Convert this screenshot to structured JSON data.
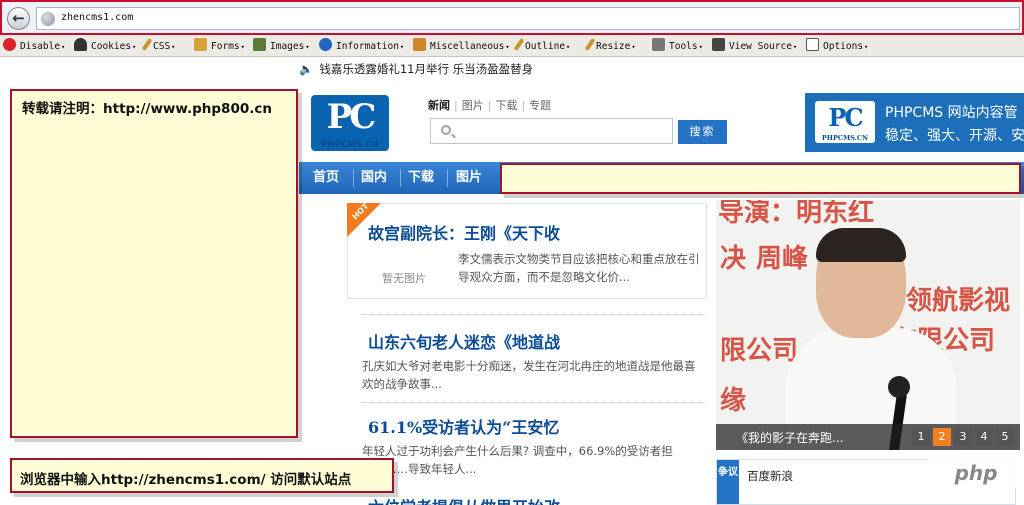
{
  "browser": {
    "url": "zhencms1.com"
  },
  "dev_toolbar": {
    "items": [
      {
        "label": "Disable",
        "icon": "disable-icon",
        "color": "#d8242a"
      },
      {
        "label": "Cookies",
        "icon": "cookies-icon",
        "color": "#333333"
      },
      {
        "label": "CSS",
        "icon": "css-icon",
        "color": "#c9962b"
      },
      {
        "label": "Forms",
        "icon": "forms-icon",
        "color": "#d7a23c"
      },
      {
        "label": "Images",
        "icon": "images-icon",
        "color": "#5b7b3a"
      },
      {
        "label": "Information",
        "icon": "information-icon",
        "color": "#2563c0"
      },
      {
        "label": "Miscellaneous",
        "icon": "miscellaneous-icon",
        "color": "#d1862c"
      },
      {
        "label": "Outline",
        "icon": "outline-icon",
        "color": "#c9962b"
      },
      {
        "label": "Resize",
        "icon": "resize-icon",
        "color": "#c9962b"
      },
      {
        "label": "Tools",
        "icon": "tools-icon",
        "color": "#777777"
      },
      {
        "label": "View Source",
        "icon": "view-source-icon",
        "color": "#444444"
      },
      {
        "label": "Options",
        "icon": "options-icon",
        "color": "#555555"
      }
    ]
  },
  "page": {
    "ticker": "钱嘉乐透露婚礼11月举行 乐当汤盈盈替身",
    "logo_text": "PC",
    "logo_caption": "PHPCMS.CN",
    "search_tabs": [
      "新闻",
      "图片",
      "下载",
      "专题"
    ],
    "search_button": "搜索",
    "banner": {
      "logo": "PC",
      "logo_caption": "PHPCMS.CN",
      "title": "PHPCMS 网站内容管",
      "subtitle": "稳定、强大、开源、安"
    },
    "nav": [
      "首页",
      "国内",
      "下载",
      "图片"
    ],
    "articles": [
      {
        "title": "故宫副院长：王刚《天下收",
        "summary": "李文儒表示文物类节目应该把核心和重点放在引导观众方面，而不是忽略文化价...",
        "image_placeholder": "暂无图片",
        "badge": "HOT"
      },
      {
        "title": "山东六旬老人迷恋《地道战",
        "summary": "孔庆如大爷对老电影十分痴迷，发生在河北冉庄的地道战是他最喜欢的战争故事..."
      },
      {
        "title": "61.1%受访者认为“王安忆",
        "summary": "年轻人过于功利会产生什么后果? 调查中，66.9%的受访者担心，……导致年轻人..."
      },
      {
        "title": "六位学者提倡从做思开始改"
      }
    ],
    "slideshow": {
      "caption": "《我的影子在奔跑...",
      "background_text": [
        "导演：明东红",
        "周峰",
        "领航影视",
        "有限公司",
        "限公司",
        "决",
        "缘"
      ],
      "pages": [
        "1",
        "2",
        "3",
        "4",
        "5"
      ],
      "active_page": "2"
    },
    "qa": {
      "tag": "争议",
      "text": "百度新浪"
    },
    "watermark": "php"
  },
  "annotations": {
    "note_top": "转载请注明：http://www.php800.cn",
    "note_bottom": "浏览器中输入http://zhencms1.com/ 访问默认站点",
    "note_nav": ""
  }
}
